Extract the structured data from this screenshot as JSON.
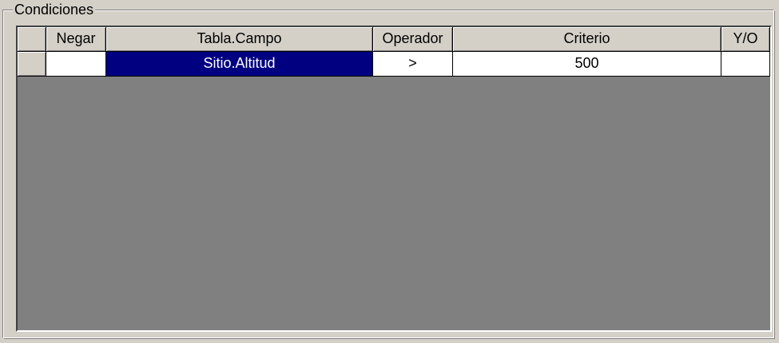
{
  "groupbox": {
    "label": "Condiciones"
  },
  "grid": {
    "columns": [
      {
        "key": "rowheader",
        "label": ""
      },
      {
        "key": "negar",
        "label": "Negar"
      },
      {
        "key": "tabla_campo",
        "label": "Tabla.Campo"
      },
      {
        "key": "operador",
        "label": "Operador"
      },
      {
        "key": "criterio",
        "label": "Criterio"
      },
      {
        "key": "y_o",
        "label": "Y/O"
      }
    ],
    "rows": [
      {
        "negar": "",
        "tabla_campo": "Sitio.Altitud",
        "operador": ">",
        "criterio": "500",
        "y_o": ""
      }
    ],
    "selected_cell": "tabla_campo",
    "selection_color": "#000080",
    "background_color": "#808080"
  }
}
